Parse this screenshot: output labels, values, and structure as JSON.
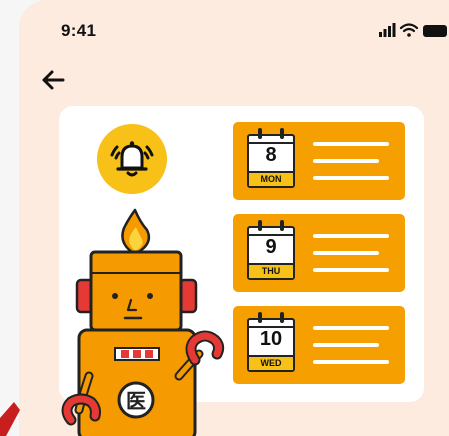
{
  "status_bar": {
    "time": "9:41",
    "icons": [
      "signal-icon",
      "wifi-icon",
      "battery-icon"
    ]
  },
  "nav": {
    "back_icon": "arrow-left-icon"
  },
  "illustration": {
    "bell_icon": "ringing-bell-icon",
    "robot_badge_glyph": "医"
  },
  "schedule": [
    {
      "day": "8",
      "weekday": "MON"
    },
    {
      "day": "9",
      "weekday": "THU"
    },
    {
      "day": "10",
      "weekday": "WED"
    }
  ],
  "colors": {
    "background": "#fdebe0",
    "card": "#ffffff",
    "accent": "#f5a000",
    "bell": "#f7c118"
  }
}
